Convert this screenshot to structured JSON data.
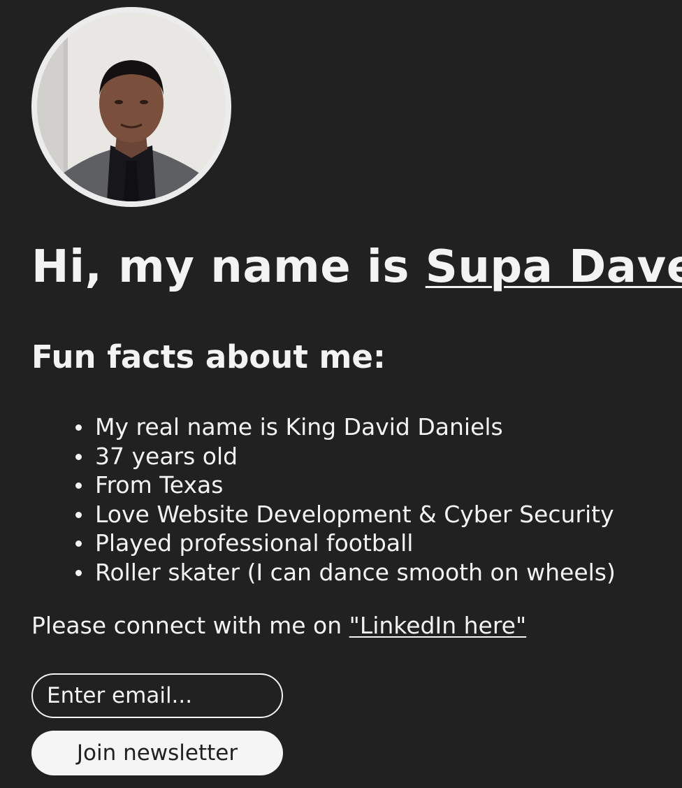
{
  "profile": {
    "photo_alt": "Supa Dave profile photo"
  },
  "heading": {
    "prefix": "Hi, my name is ",
    "name_link": "Supa Dave"
  },
  "fun_facts": {
    "title": "Fun facts about me:",
    "items": [
      "My real name is King David Daniels",
      "37 years old",
      "From Texas",
      "Love Website Development & Cyber Security",
      "Played professional football",
      "Roller skater (I can dance smooth on wheels)"
    ]
  },
  "connect": {
    "prefix": "Please connect with me on ",
    "link_text": "\"LinkedIn here\""
  },
  "newsletter": {
    "placeholder": "Enter email...",
    "button_label": "Join newsletter"
  },
  "colors": {
    "background": "#212121",
    "text": "#f3f3f3",
    "button_bg": "#f5f5f5",
    "button_text": "#212121"
  }
}
